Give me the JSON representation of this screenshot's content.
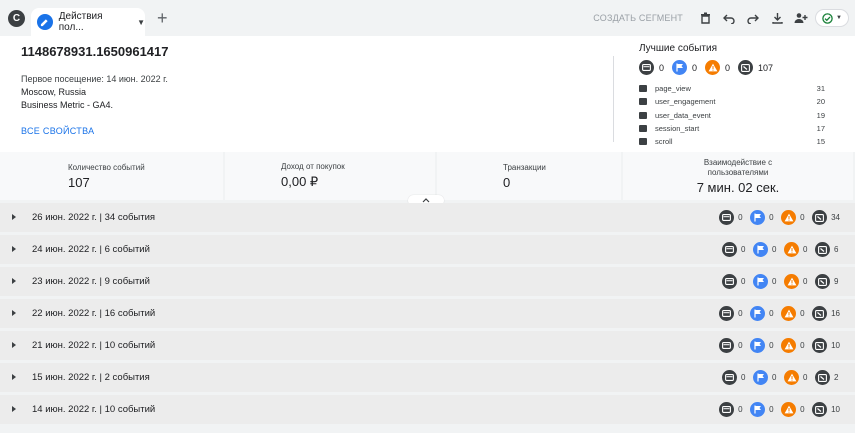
{
  "topbar": {
    "segment_letter": "C",
    "tab_label": "Действия пол...",
    "create_segment": "СОЗДАТЬ СЕГМЕНТ"
  },
  "user": {
    "id": "1148678931.1650961417",
    "first_visit": "Первое посещение: 14 июн. 2022 г.",
    "location": "Moscow, Russia",
    "property": "Business Metric - GA4.",
    "all_props": "ВСЕ СВОЙСТВА"
  },
  "best_events": {
    "title": "Лучшие события",
    "counts": {
      "screen": "0",
      "flag": "0",
      "warning": "0",
      "event": "107"
    },
    "items": [
      {
        "name": "page_view",
        "count": "31"
      },
      {
        "name": "user_engagement",
        "count": "20"
      },
      {
        "name": "user_data_event",
        "count": "19"
      },
      {
        "name": "session_start",
        "count": "17"
      },
      {
        "name": "scroll",
        "count": "15"
      }
    ]
  },
  "metrics": [
    {
      "label": "Количество событий",
      "value": "107"
    },
    {
      "label": "Доход от покупок",
      "value": "0,00 ₽"
    },
    {
      "label": "Транзакции",
      "value": "0"
    },
    {
      "label": "Взаимодействие с пользователями",
      "value": "7 мин. 02 сек."
    }
  ],
  "days": [
    {
      "title": "26 июн. 2022 г. | 34 события",
      "c1": "0",
      "c2": "0",
      "c3": "0",
      "c4": "34"
    },
    {
      "title": "24 июн. 2022 г. | 6 событий",
      "c1": "0",
      "c2": "0",
      "c3": "0",
      "c4": "6"
    },
    {
      "title": "23 июн. 2022 г. | 9 событий",
      "c1": "0",
      "c2": "0",
      "c3": "0",
      "c4": "9"
    },
    {
      "title": "22 июн. 2022 г. | 16 событий",
      "c1": "0",
      "c2": "0",
      "c3": "0",
      "c4": "16"
    },
    {
      "title": "21 июн. 2022 г. | 10 событий",
      "c1": "0",
      "c2": "0",
      "c3": "0",
      "c4": "10"
    },
    {
      "title": "15 июн. 2022 г. | 2 события",
      "c1": "0",
      "c2": "0",
      "c3": "0",
      "c4": "2"
    },
    {
      "title": "14 июн. 2022 г. | 10 событий",
      "c1": "0",
      "c2": "0",
      "c3": "0",
      "c4": "10"
    }
  ],
  "colors": {
    "accent": "#1a73e8",
    "dark_icon": "#3c4043",
    "flag_icon": "#4285f4",
    "warning_icon": "#f57c00"
  }
}
